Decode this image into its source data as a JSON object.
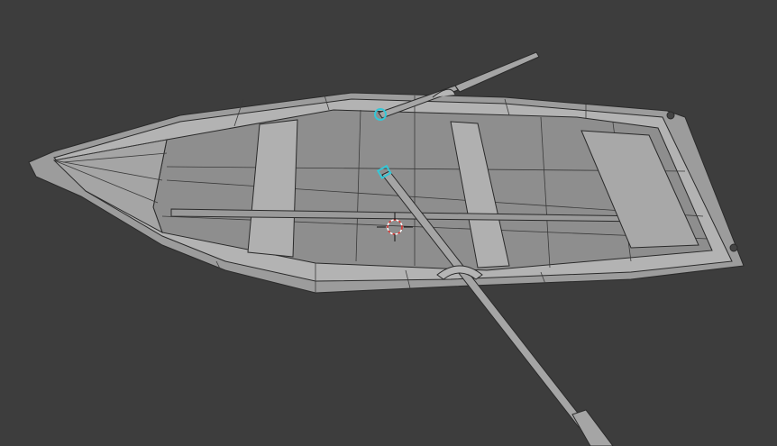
{
  "viewport": {
    "background_color": "#3d3d3d",
    "mesh_fill_color": "#a9a9a9",
    "mesh_inner_color": "#8f8f8f",
    "wire_color": "#2a2a2a",
    "selected_color": "#35c7d6",
    "cursor_color": "#e0332f"
  },
  "icons": {
    "cursor": "3d-cursor-icon"
  }
}
